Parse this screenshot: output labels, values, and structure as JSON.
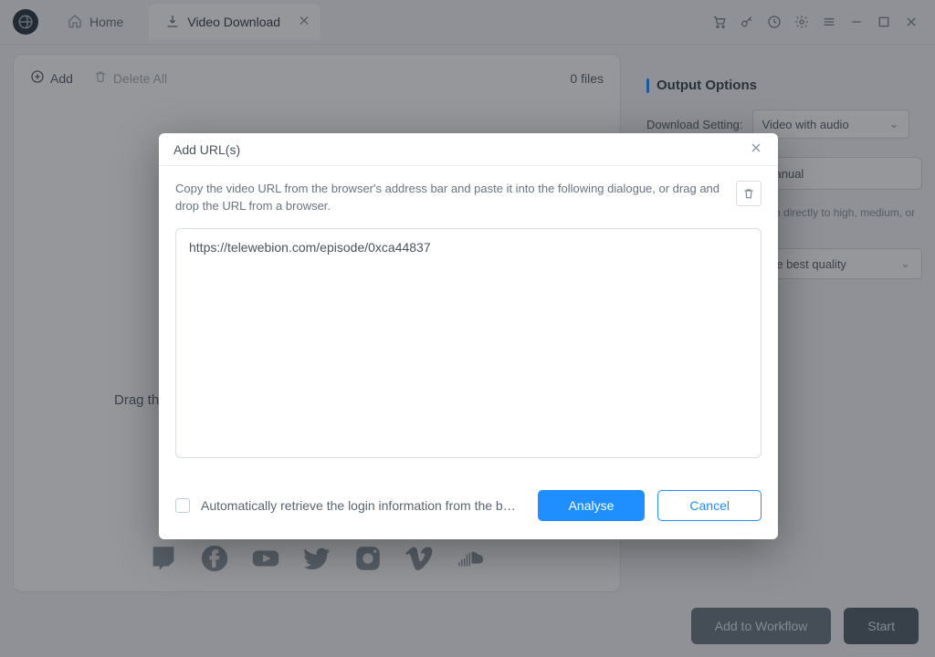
{
  "titlebar": {
    "home_label": "Home",
    "active_tab_label": "Video Download"
  },
  "left": {
    "add_label": "Add",
    "delete_all_label": "Delete All",
    "count_label": "0 files",
    "drag_hint": "Drag the video URL here.",
    "social_icons": [
      "twitch-icon",
      "facebook-icon",
      "youtube-icon",
      "twitter-icon",
      "instagram-icon",
      "vimeo-icon",
      "soundcloud-icon"
    ]
  },
  "right": {
    "title": "Output Options",
    "dl_setting_label": "Download Setting:",
    "dl_setting_value": "Video with audio",
    "mode_manual": "Manual",
    "hint": "Get the preferred resolution directly to high, medium, or low.",
    "quality_value": "Automatically select the best quality"
  },
  "footer": {
    "add_workflow": "Add to Workflow",
    "start": "Start"
  },
  "modal": {
    "title": "Add URL(s)",
    "desc": "Copy the video URL from the browser's address bar and paste it into the following dialogue, or drag and drop the URL from a browser.",
    "url_value": "https://telewebion.com/episode/0xca44837",
    "checkbox_label": "Automatically retrieve the login information from the b…",
    "analyse": "Analyse",
    "cancel": "Cancel"
  }
}
